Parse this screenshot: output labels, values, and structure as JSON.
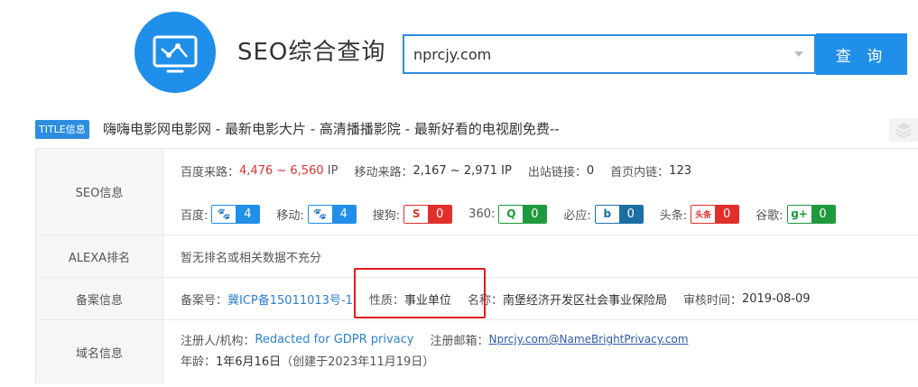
{
  "header": {
    "brand": "SEO综合查询",
    "search_value": "nprcjy.com",
    "search_button": "查 询"
  },
  "title_row": {
    "badge": "TITLE信息",
    "text": "嗨嗨电影网电影网 - 最新电影大片 - 高清播播影院 - 最新好看的电视剧免费--"
  },
  "seo": {
    "label": "SEO信息",
    "baidu_traffic_label": "百度来路：",
    "baidu_traffic_low": "4,476",
    "baidu_traffic_sep": " ~ ",
    "baidu_traffic_high": "6,560",
    "baidu_traffic_unit": " IP",
    "mobile_traffic_label": "移动来路：",
    "mobile_traffic_value": "2,167 ~ 2,971 IP",
    "outbound_label": "出站链接：",
    "outbound_value": "0",
    "inner_label": "首页内链：",
    "inner_value": "123",
    "ranks": [
      {
        "label": "百度:",
        "icon": "paw-icon",
        "glyph": "🐾",
        "value": "4",
        "color": "#1f8fea"
      },
      {
        "label": "移动:",
        "icon": "paw-icon",
        "glyph": "🐾",
        "value": "4",
        "color": "#1f8fea"
      },
      {
        "label": "搜狗:",
        "icon": "sogou-icon",
        "glyph": "S",
        "value": "0",
        "color": "#e0302c"
      },
      {
        "label": "360:",
        "icon": "360-icon",
        "glyph": "Q",
        "value": "0",
        "color": "#1e9a3c"
      },
      {
        "label": "必应:",
        "icon": "bing-icon",
        "glyph": "b",
        "value": "0",
        "color": "#1c6fa3"
      },
      {
        "label": "头条:",
        "icon": "toutiao-icon",
        "glyph": "头条",
        "value": "0",
        "color": "#e0302c"
      },
      {
        "label": "谷歌:",
        "icon": "google-plus-icon",
        "glyph": "g+",
        "value": "0",
        "color": "#1e9a3c"
      }
    ]
  },
  "alexa": {
    "label": "ALEXA排名",
    "text": "暂无排名或相关数据不充分"
  },
  "icp": {
    "label": "备案信息",
    "number_label": "备案号：",
    "number_value": "冀ICP备15011013号-1",
    "nature_label": "性质：",
    "nature_value": "事业单位",
    "name_label": "名称：",
    "name_value": "南堡经济开发区社会事业保险局",
    "audit_label": "审核时间：",
    "audit_value": "2019-08-09"
  },
  "domain": {
    "label": "域名信息",
    "registrant_label": "注册人/机构：",
    "registrant_value": "Redacted for GDPR privacy",
    "email_label": "注册邮箱：",
    "email_value": "Nprcjy.com@NameBrightPrivacy.com",
    "age_label": "年龄：",
    "age_value": "1年6月16日",
    "created": "（创建于2023年11月19日）"
  }
}
